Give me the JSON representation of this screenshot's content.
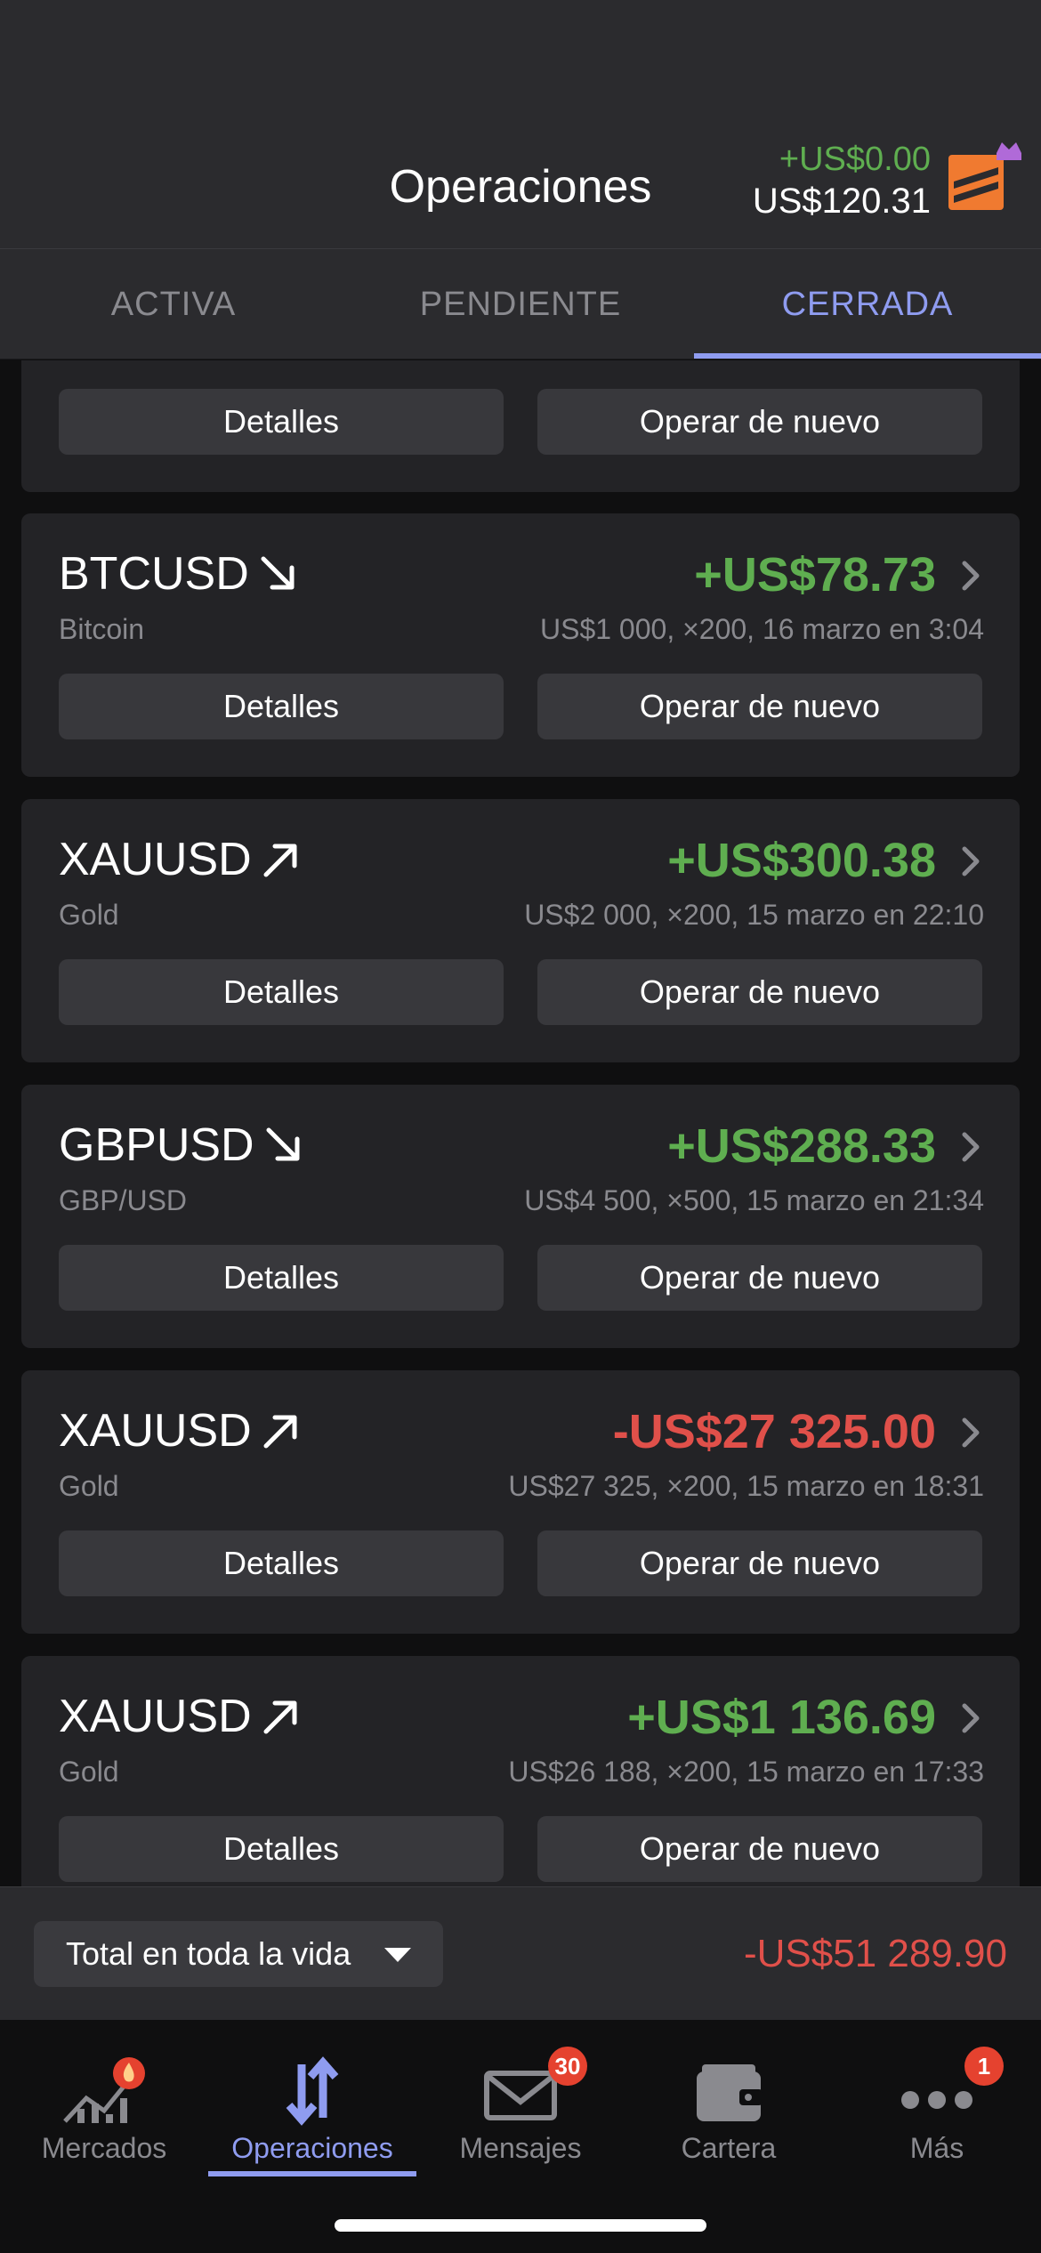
{
  "header": {
    "title": "Operaciones",
    "day_pnl": "+US$0.00",
    "balance": "US$120.31",
    "logo_icon": "broker-logo-icon"
  },
  "tabs": [
    {
      "label": "ACTIVA",
      "active": false
    },
    {
      "label": "PENDIENTE",
      "active": false
    },
    {
      "label": "CERRADA",
      "active": true
    }
  ],
  "cards": {
    "top_partial": {
      "details_label": "Detalles",
      "again_label": "Operar de nuevo"
    },
    "items": [
      {
        "symbol": "BTCUSD",
        "direction": "down",
        "name": "Bitcoin",
        "pnl": "+US$78.73",
        "pnl_type": "positive",
        "meta": "US$1 000, ×200, 16 marzo en 3:04",
        "details_label": "Detalles",
        "again_label": "Operar de nuevo"
      },
      {
        "symbol": "XAUUSD",
        "direction": "up",
        "name": "Gold",
        "pnl": "+US$300.38",
        "pnl_type": "positive",
        "meta": "US$2 000, ×200, 15 marzo en 22:10",
        "details_label": "Detalles",
        "again_label": "Operar de nuevo"
      },
      {
        "symbol": "GBPUSD",
        "direction": "down",
        "name": "GBP/USD",
        "pnl": "+US$288.33",
        "pnl_type": "positive",
        "meta": "US$4 500, ×500, 15 marzo en 21:34",
        "details_label": "Detalles",
        "again_label": "Operar de nuevo"
      },
      {
        "symbol": "XAUUSD",
        "direction": "up",
        "name": "Gold",
        "pnl": "-US$27 325.00",
        "pnl_type": "negative",
        "meta": "US$27 325, ×200, 15 marzo en 18:31",
        "details_label": "Detalles",
        "again_label": "Operar de nuevo"
      },
      {
        "symbol": "XAUUSD",
        "direction": "up",
        "name": "Gold",
        "pnl": "+US$1 136.69",
        "pnl_type": "positive",
        "meta": "US$26 188, ×200, 15 marzo en 17:33",
        "details_label": "Detalles",
        "again_label": "Operar de nuevo"
      }
    ]
  },
  "summary": {
    "period_label": "Total en toda la vida",
    "total": "-US$51 289.90"
  },
  "nav": [
    {
      "label": "Mercados",
      "icon": "markets-icon",
      "badge": "",
      "active": false
    },
    {
      "label": "Operaciones",
      "icon": "trades-icon",
      "badge": "",
      "active": true
    },
    {
      "label": "Mensajes",
      "icon": "messages-icon",
      "badge": "30",
      "active": false
    },
    {
      "label": "Cartera",
      "icon": "wallet-icon",
      "badge": "",
      "active": false
    },
    {
      "label": "Más",
      "icon": "more-icon",
      "badge": "1",
      "active": false
    }
  ],
  "colors": {
    "positive": "#5fae50",
    "negative": "#e0504a",
    "accent": "#8f9cf0",
    "badge": "#e5422f"
  }
}
